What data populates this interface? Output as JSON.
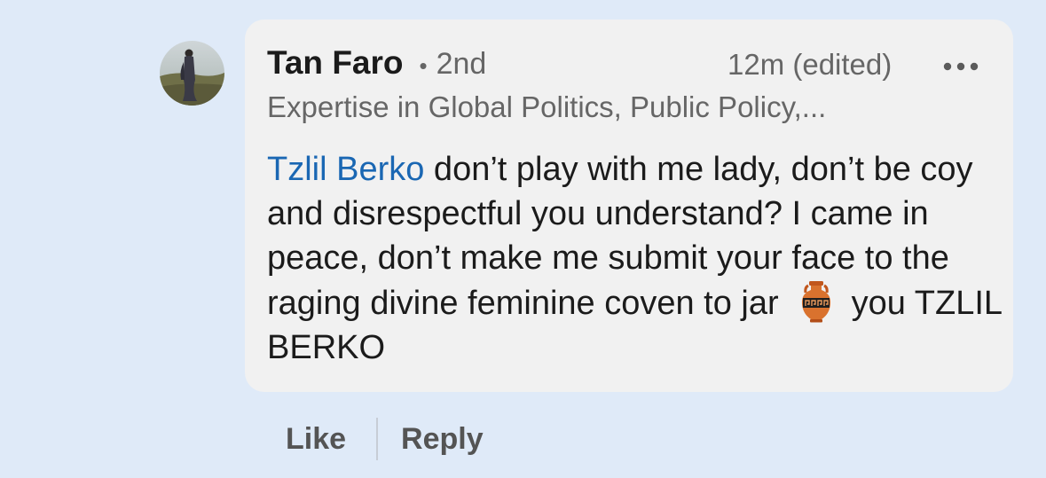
{
  "comment": {
    "author": {
      "name": "Tan Faro",
      "degree_separator": "•",
      "degree": "2nd",
      "headline": "Expertise in Global Politics, Public Policy,..."
    },
    "timestamp": "12m (edited)",
    "more_icon": "more-horizontal-icon",
    "body": {
      "mention": "Tzlil Berko",
      "text_before_emoji": " don’t play with me lady, don’t be coy and disrespectful you understand? I came in peace, don’t make me submit your face to the raging divine feminine coven to jar",
      "emoji": "amphora",
      "text_after_emoji": "you TZLIL BERKO"
    },
    "actions": {
      "like_label": "Like",
      "reply_label": "Reply"
    }
  },
  "colors": {
    "page_background": "#dfeaf8",
    "bubble_background": "#f1f1f1",
    "mention": "#1a67b3",
    "primary_text": "#1b1b1b",
    "secondary_text": "#666666"
  }
}
